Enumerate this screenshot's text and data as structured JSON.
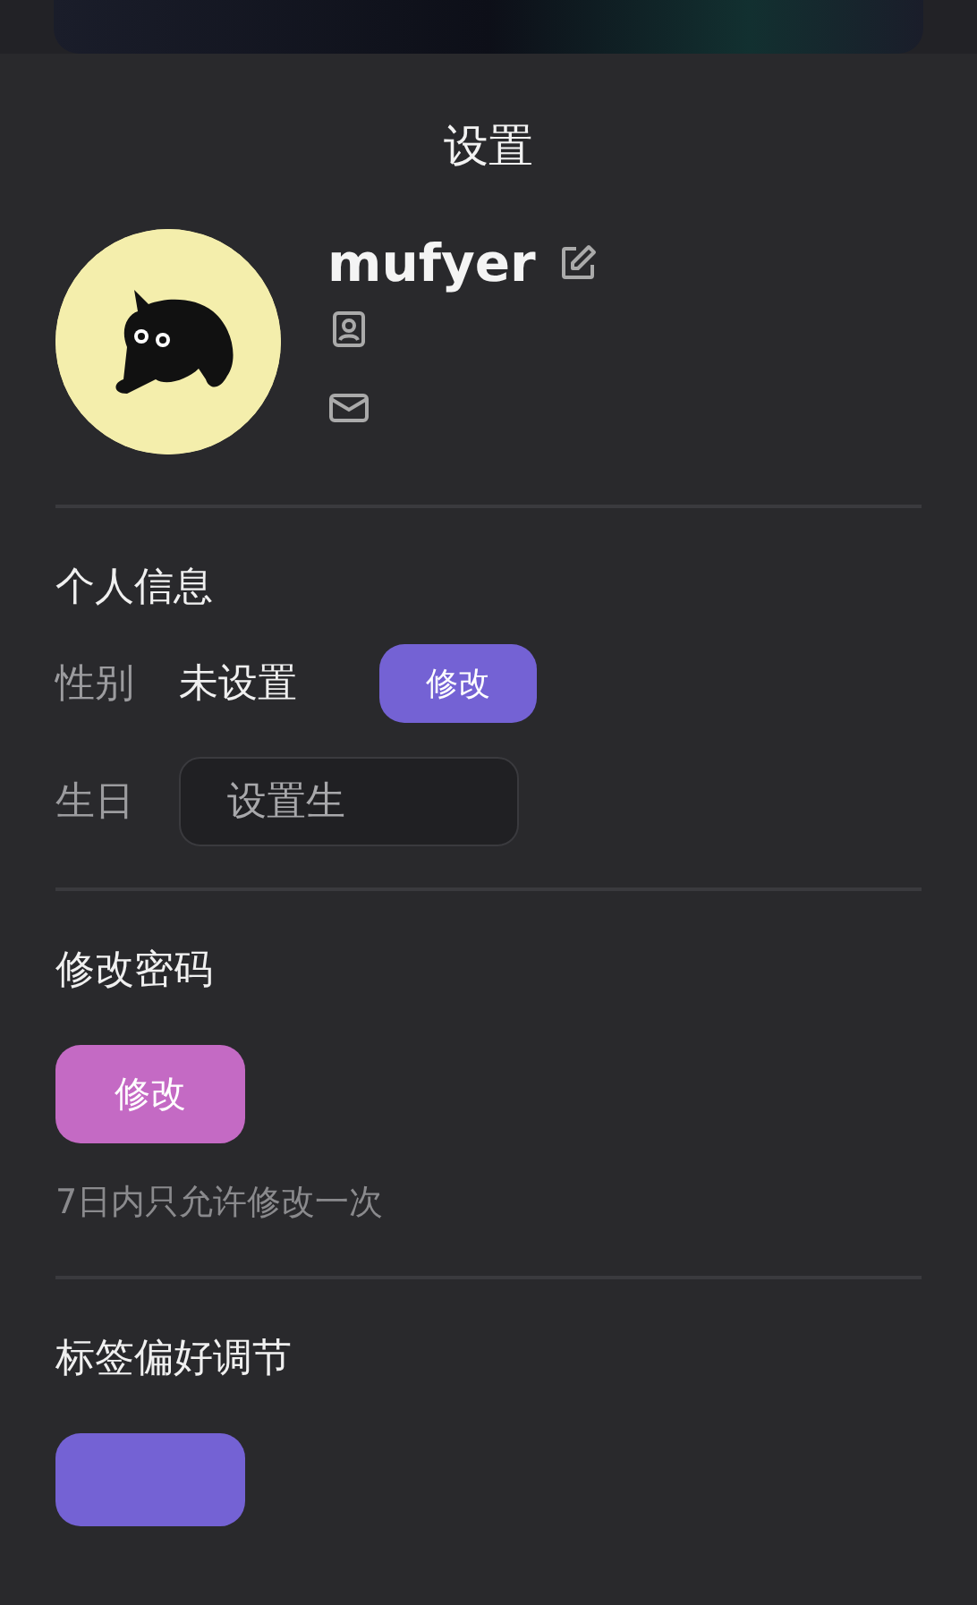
{
  "title": "设置",
  "profile": {
    "username": "mufyer"
  },
  "personal_info": {
    "heading": "个人信息",
    "gender": {
      "label": "性别",
      "value": "未设置",
      "button": "修改"
    },
    "birthday": {
      "label": "生日",
      "placeholder": "设置生"
    }
  },
  "password": {
    "heading": "修改密码",
    "button": "修改",
    "note": "7日内只允许修改一次"
  },
  "tag_preferences": {
    "heading": "标签偏好调节"
  }
}
